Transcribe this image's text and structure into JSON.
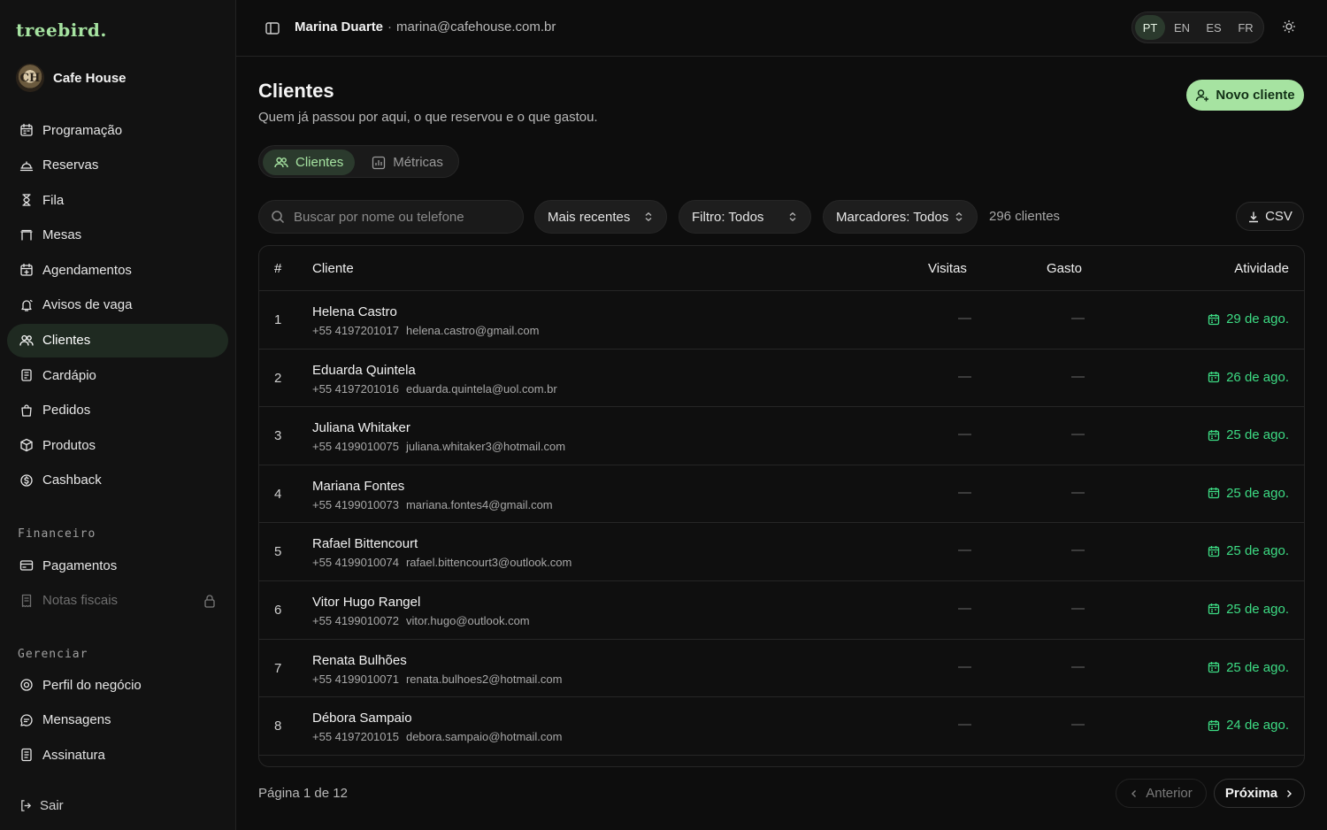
{
  "brand": "treebird.",
  "business": {
    "name": "Cafe House",
    "avatar_initials": "CH"
  },
  "nav_main": [
    {
      "label": "Programação",
      "icon": "calendar-icon"
    },
    {
      "label": "Reservas",
      "icon": "reservation-icon"
    },
    {
      "label": "Fila",
      "icon": "hourglass-icon"
    },
    {
      "label": "Mesas",
      "icon": "table-icon"
    },
    {
      "label": "Agendamentos",
      "icon": "calendar-plus-icon"
    },
    {
      "label": "Avisos de vaga",
      "icon": "bell-icon"
    },
    {
      "label": "Clientes",
      "icon": "users-icon",
      "active": true
    },
    {
      "label": "Cardápio",
      "icon": "menu-book-icon"
    },
    {
      "label": "Pedidos",
      "icon": "bag-icon"
    },
    {
      "label": "Produtos",
      "icon": "package-icon"
    },
    {
      "label": "Cashback",
      "icon": "coin-icon"
    }
  ],
  "section_finance": "Financeiro",
  "nav_finance": [
    {
      "label": "Pagamentos",
      "icon": "card-icon"
    },
    {
      "label": "Notas fiscais",
      "icon": "receipt-icon",
      "locked": true
    }
  ],
  "section_manage": "Gerenciar",
  "nav_manage": [
    {
      "label": "Perfil do negócio",
      "icon": "location-icon"
    },
    {
      "label": "Mensagens",
      "icon": "message-icon"
    },
    {
      "label": "Assinatura",
      "icon": "document-icon"
    }
  ],
  "logout": "Sair",
  "header": {
    "user_name": "Marina Duarte",
    "separator": "·",
    "user_email": "marina@cafehouse.com.br",
    "languages": [
      "PT",
      "EN",
      "ES",
      "FR"
    ],
    "active_language": "PT"
  },
  "page": {
    "title": "Clientes",
    "subtitle": "Quem já passou por aqui, o que reservou e o que gastou.",
    "new_button": "Novo cliente",
    "tabs": [
      "Clientes",
      "Métricas"
    ]
  },
  "toolbar": {
    "search_placeholder": "Buscar por nome ou telefone",
    "sort": "Mais recentes",
    "filter": "Filtro: Todos",
    "tags": "Marcadores: Todos",
    "count": "296 clientes",
    "csv": "CSV"
  },
  "table": {
    "headers": {
      "index": "#",
      "client": "Cliente",
      "visits": "Visitas",
      "spent": "Gasto",
      "activity": "Atividade"
    },
    "rows": [
      {
        "index": "1",
        "name": "Helena Castro",
        "phone": "+55 4197201017",
        "email": "helena.castro@gmail.com",
        "visits": "—",
        "spent": "—",
        "activity": "29 de ago."
      },
      {
        "index": "2",
        "name": "Eduarda Quintela",
        "phone": "+55 4197201016",
        "email": "eduarda.quintela@uol.com.br",
        "visits": "—",
        "spent": "—",
        "activity": "26 de ago."
      },
      {
        "index": "3",
        "name": "Juliana Whitaker",
        "phone": "+55 4199010075",
        "email": "juliana.whitaker3@hotmail.com",
        "visits": "—",
        "spent": "—",
        "activity": "25 de ago."
      },
      {
        "index": "4",
        "name": "Mariana Fontes",
        "phone": "+55 4199010073",
        "email": "mariana.fontes4@gmail.com",
        "visits": "—",
        "spent": "—",
        "activity": "25 de ago."
      },
      {
        "index": "5",
        "name": "Rafael Bittencourt",
        "phone": "+55 4199010074",
        "email": "rafael.bittencourt3@outlook.com",
        "visits": "—",
        "spent": "—",
        "activity": "25 de ago."
      },
      {
        "index": "6",
        "name": "Vitor Hugo Rangel",
        "phone": "+55 4199010072",
        "email": "vitor.hugo@outlook.com",
        "visits": "—",
        "spent": "—",
        "activity": "25 de ago."
      },
      {
        "index": "7",
        "name": "Renata Bulhões",
        "phone": "+55 4199010071",
        "email": "renata.bulhoes2@hotmail.com",
        "visits": "—",
        "spent": "—",
        "activity": "25 de ago."
      },
      {
        "index": "8",
        "name": "Débora Sampaio",
        "phone": "+55 4197201015",
        "email": "debora.sampaio@hotmail.com",
        "visits": "—",
        "spent": "—",
        "activity": "24 de ago."
      }
    ]
  },
  "pagination": {
    "info": "Página 1 de 12",
    "prev": "Anterior",
    "next": "Próxima"
  },
  "colors": {
    "accent": "#a6e3a1",
    "activity": "#3ddc84",
    "background": "#0d0d0d"
  }
}
